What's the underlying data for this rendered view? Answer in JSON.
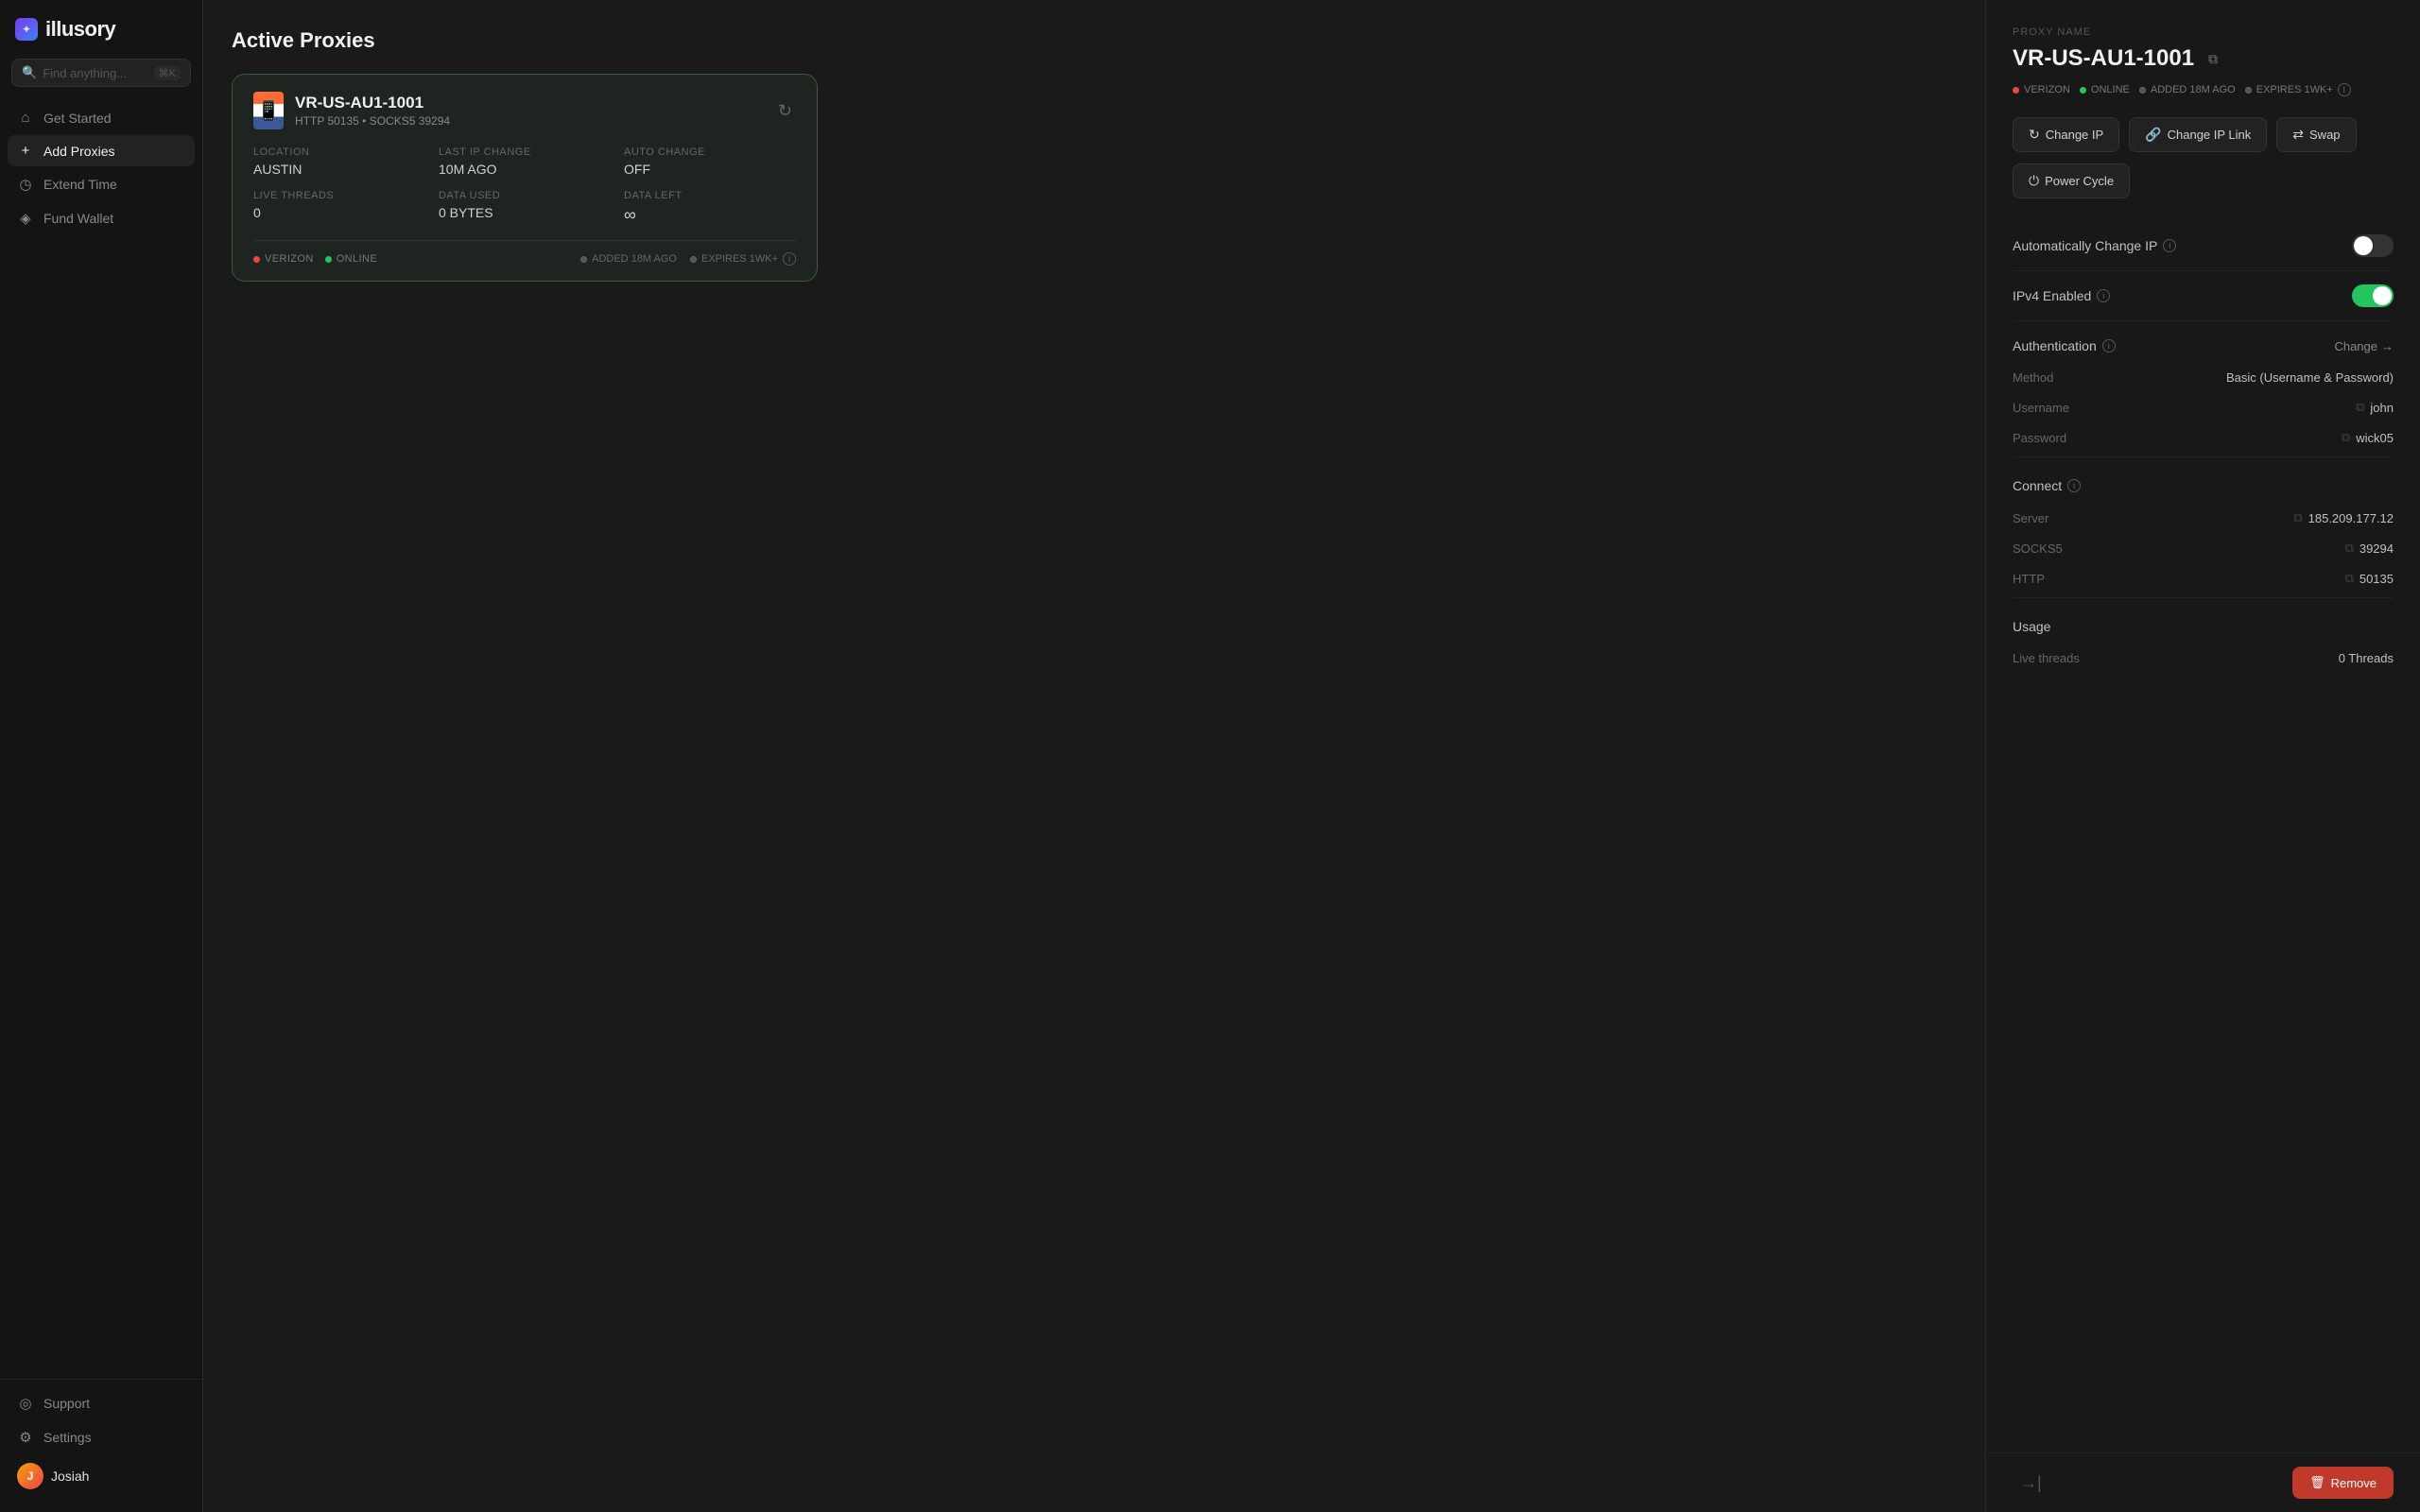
{
  "app": {
    "logo_text": "illusory",
    "logo_icon": "✦"
  },
  "sidebar": {
    "search_placeholder": "Find anything...",
    "search_shortcut": "⌘K",
    "nav_items": [
      {
        "id": "get-started",
        "label": "Get Started",
        "icon": "⌂"
      },
      {
        "id": "add-proxies",
        "label": "Add Proxies",
        "icon": "+"
      },
      {
        "id": "extend-time",
        "label": "Extend Time",
        "icon": "◷"
      },
      {
        "id": "fund-wallet",
        "label": "Fund Wallet",
        "icon": "◈"
      }
    ],
    "bottom_items": [
      {
        "id": "support",
        "label": "Support",
        "icon": "◎"
      },
      {
        "id": "settings",
        "label": "Settings",
        "icon": "⚙"
      }
    ],
    "user": {
      "name": "Josiah",
      "initials": "J"
    }
  },
  "main": {
    "page_title": "Active Proxies",
    "proxy_card": {
      "name": "VR-US-AU1-1001",
      "subtitle": "HTTP 50135 • SOCKS5 39294",
      "location_label": "LOCATION",
      "location_value": "AUSTIN",
      "last_ip_label": "LAST IP CHANGE",
      "last_ip_value": "10M AGO",
      "auto_change_label": "AUTO CHANGE",
      "auto_change_value": "OFF",
      "threads_label": "LIVE THREADS",
      "threads_value": "0",
      "data_used_label": "DATA USED",
      "data_used_value": "0 BYTES",
      "data_left_label": "DATA LEFT",
      "data_left_value": "∞",
      "tags": {
        "carrier": "VERIZON",
        "status": "ONLINE",
        "added": "ADDED 18M AGO",
        "expires": "EXPIRES 1WK+"
      }
    }
  },
  "panel": {
    "proxy_name_label": "PROXY NAME",
    "proxy_name": "VR-US-AU1-1001",
    "tags": {
      "carrier": "VERIZON",
      "status": "ONLINE",
      "added": "ADDED 18M AGO",
      "expires": "EXPIRES 1WK+"
    },
    "buttons": {
      "change_ip": "Change IP",
      "change_ip_link": "Change IP Link",
      "swap": "Swap",
      "power_cycle": "Power Cycle"
    },
    "auto_change_ip_label": "Automatically Change IP",
    "ipv4_label": "IPv4 Enabled",
    "authentication_label": "Authentication",
    "change_label": "Change",
    "method_label": "Method",
    "method_value": "Basic (Username & Password)",
    "username_label": "Username",
    "username_value": "john",
    "password_label": "Password",
    "password_value": "wick05",
    "connect_label": "Connect",
    "server_label": "Server",
    "server_value": "185.209.177.12",
    "socks5_label": "SOCKS5",
    "socks5_value": "39294",
    "http_label": "HTTP",
    "http_value": "50135",
    "usage_label": "Usage",
    "live_threads_label": "Live threads",
    "live_threads_value": "0 Threads",
    "remove_label": "Remove"
  },
  "icons": {
    "refresh": "↻",
    "copy": "⧉",
    "info": "i",
    "change_ip": "↻",
    "link": "🔗",
    "swap": "⇄",
    "power": "⏻",
    "arrow_right": "→",
    "collapse": "→|",
    "trash": "🗑"
  }
}
